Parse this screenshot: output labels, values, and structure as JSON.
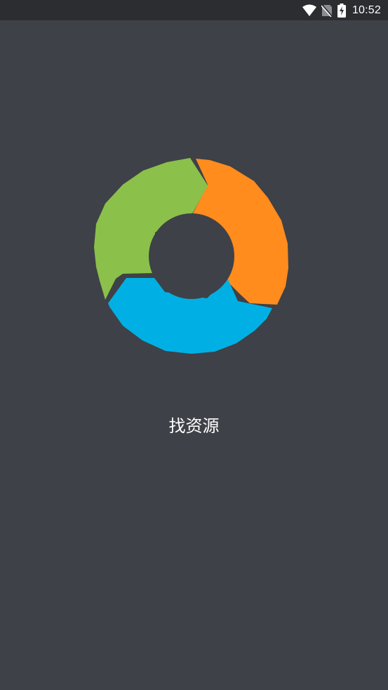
{
  "status_bar": {
    "time": "10:52",
    "icons": [
      "wifi-icon",
      "no-sim-icon",
      "battery-charging-icon"
    ],
    "colors": {
      "background": "#2b2d31",
      "foreground": "#ffffff"
    }
  },
  "splash": {
    "app_name": "找资源",
    "logo": {
      "icon": "cycle-arrows-logo",
      "colors": [
        "#8bc04b",
        "#ff8c1d",
        "#00b0e4"
      ]
    },
    "background": "#3e4147"
  }
}
